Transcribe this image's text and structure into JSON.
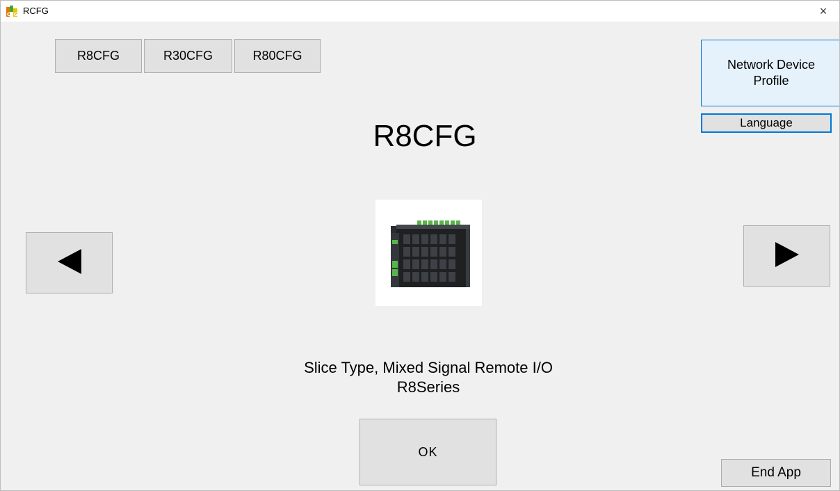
{
  "window": {
    "title": "RCFG",
    "close_glyph": "×"
  },
  "tabs": [
    {
      "label": "R8CFG"
    },
    {
      "label": "R30CFG"
    },
    {
      "label": "R80CFG"
    }
  ],
  "side": {
    "network_device_profile_line1": "Network Device",
    "network_device_profile_line2": "Profile",
    "language_label": "Language"
  },
  "main": {
    "title": "R8CFG",
    "description_line1": "Slice Type, Mixed Signal Remote I/O",
    "description_line2": "R8Series",
    "ok_label": "OK",
    "end_app_label": "End App"
  },
  "icons": {
    "prev": "triangle-left-icon",
    "next": "triangle-right-icon",
    "app": "rcfg-app-icon"
  },
  "colors": {
    "accent": "#0078d7",
    "button_bg": "#e1e1e1",
    "highlight_bg": "#e5f1fb",
    "window_bg": "#f0f0f0"
  }
}
